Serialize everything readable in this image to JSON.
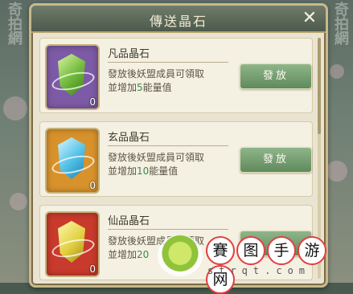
{
  "window": {
    "title": "傳送晶石"
  },
  "items": [
    {
      "name": "凡品晶石",
      "desc_line1": "發放後妖盟成員可領取",
      "desc_line2_prefix": "並增加",
      "desc_amount": "5",
      "desc_line2_suffix": "能量值",
      "count": "0",
      "button_label": "發放",
      "gem_color": "#9bd35a",
      "frame_color": "#7d5aa6"
    },
    {
      "name": "玄品晶石",
      "desc_line1": "發放後妖盟成員可領取",
      "desc_line2_prefix": "並增加",
      "desc_amount": "10",
      "desc_line2_suffix": "能量值",
      "count": "0",
      "button_label": "發放",
      "gem_color": "#5fc8e8",
      "frame_color": "#d8922c"
    },
    {
      "name": "仙品晶石",
      "desc_line1": "發放後妖盟成員可領取",
      "desc_line2_prefix": "並增加",
      "desc_amount": "20",
      "desc_line2_suffix": "",
      "count": "0",
      "button_label": "",
      "gem_color": "#e6d648",
      "frame_color": "#c83a2c"
    }
  ],
  "watermark": {
    "chars": [
      "賽",
      "图",
      "手",
      "游",
      "网"
    ],
    "url": "strqt.com"
  },
  "side_watermark": "奇拍網",
  "colors": {
    "button": "#6f9a6a",
    "panel": "#e9e4d2",
    "accent_number": "#3a8a4a"
  }
}
